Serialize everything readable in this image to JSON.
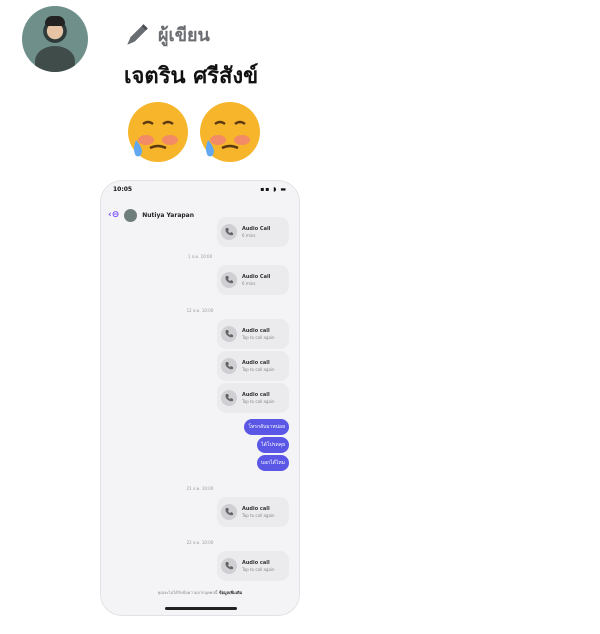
{
  "post": {
    "role_label": "ผู้เขียน",
    "author_name": "เจตริน ศรีสังข์"
  },
  "screenshot": {
    "contact_name": "Nutiya Yarapan",
    "timestamps": [
      "1 ส.ค. 10:00",
      "12 ส.ค. 10:00",
      "21 ส.ค. 10:00",
      "22 ส.ค. 10:00",
      "22 ส.ค. 10:00"
    ],
    "calls": [
      {
        "title": "Audio Call",
        "subtitle": "6 mins"
      },
      {
        "title": "Audio Call",
        "subtitle": "6 mins"
      },
      {
        "title": "Audio call",
        "subtitle": "Tap to call again"
      },
      {
        "title": "Audio call",
        "subtitle": "Tap to call again"
      },
      {
        "title": "Audio call",
        "subtitle": "Tap to call again"
      },
      {
        "title": "Audio call",
        "subtitle": "Tap to call again"
      },
      {
        "title": "Audio call",
        "subtitle": "Tap to call again"
      }
    ],
    "bubbles": [
      "โทรกลับมาหน่อย",
      "ได้โปรดคุย",
      "บอกได้ไหม"
    ],
    "footer_text": "คุณจะไม่ได้รับข้อความจากบุคคลนี้",
    "footer_link": "ข้อมูลเพิ่มเติม"
  }
}
